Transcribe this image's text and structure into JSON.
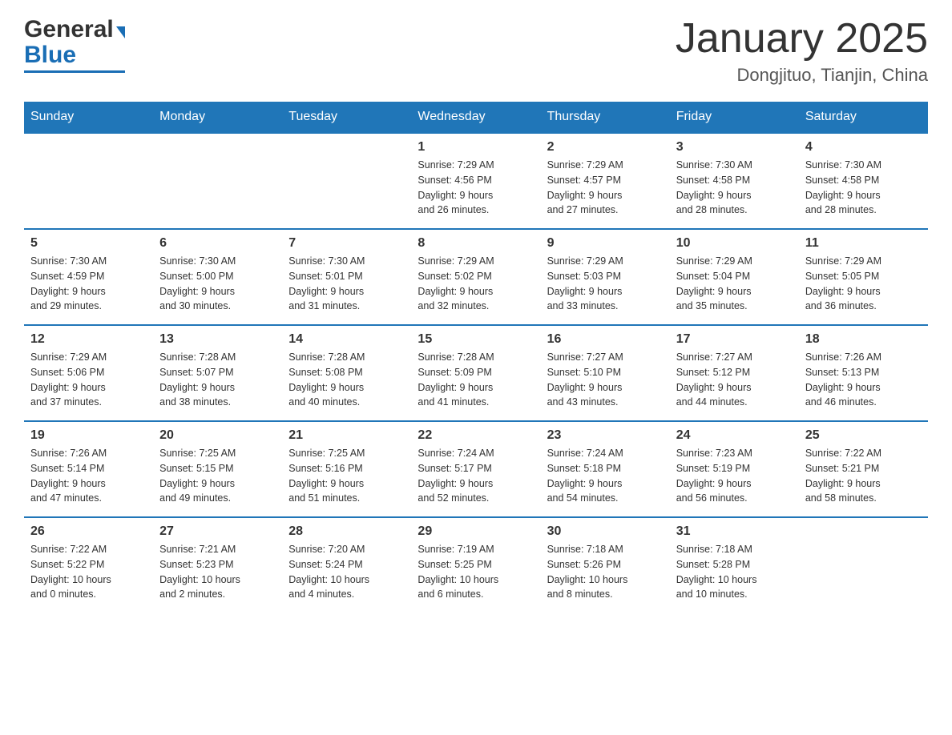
{
  "header": {
    "logo": {
      "general": "General",
      "blue": "Blue",
      "arrow": "▶"
    },
    "title": "January 2025",
    "location": "Dongjituo, Tianjin, China"
  },
  "days_of_week": [
    "Sunday",
    "Monday",
    "Tuesday",
    "Wednesday",
    "Thursday",
    "Friday",
    "Saturday"
  ],
  "weeks": [
    [
      {
        "num": "",
        "info": ""
      },
      {
        "num": "",
        "info": ""
      },
      {
        "num": "",
        "info": ""
      },
      {
        "num": "1",
        "info": "Sunrise: 7:29 AM\nSunset: 4:56 PM\nDaylight: 9 hours\nand 26 minutes."
      },
      {
        "num": "2",
        "info": "Sunrise: 7:29 AM\nSunset: 4:57 PM\nDaylight: 9 hours\nand 27 minutes."
      },
      {
        "num": "3",
        "info": "Sunrise: 7:30 AM\nSunset: 4:58 PM\nDaylight: 9 hours\nand 28 minutes."
      },
      {
        "num": "4",
        "info": "Sunrise: 7:30 AM\nSunset: 4:58 PM\nDaylight: 9 hours\nand 28 minutes."
      }
    ],
    [
      {
        "num": "5",
        "info": "Sunrise: 7:30 AM\nSunset: 4:59 PM\nDaylight: 9 hours\nand 29 minutes."
      },
      {
        "num": "6",
        "info": "Sunrise: 7:30 AM\nSunset: 5:00 PM\nDaylight: 9 hours\nand 30 minutes."
      },
      {
        "num": "7",
        "info": "Sunrise: 7:30 AM\nSunset: 5:01 PM\nDaylight: 9 hours\nand 31 minutes."
      },
      {
        "num": "8",
        "info": "Sunrise: 7:29 AM\nSunset: 5:02 PM\nDaylight: 9 hours\nand 32 minutes."
      },
      {
        "num": "9",
        "info": "Sunrise: 7:29 AM\nSunset: 5:03 PM\nDaylight: 9 hours\nand 33 minutes."
      },
      {
        "num": "10",
        "info": "Sunrise: 7:29 AM\nSunset: 5:04 PM\nDaylight: 9 hours\nand 35 minutes."
      },
      {
        "num": "11",
        "info": "Sunrise: 7:29 AM\nSunset: 5:05 PM\nDaylight: 9 hours\nand 36 minutes."
      }
    ],
    [
      {
        "num": "12",
        "info": "Sunrise: 7:29 AM\nSunset: 5:06 PM\nDaylight: 9 hours\nand 37 minutes."
      },
      {
        "num": "13",
        "info": "Sunrise: 7:28 AM\nSunset: 5:07 PM\nDaylight: 9 hours\nand 38 minutes."
      },
      {
        "num": "14",
        "info": "Sunrise: 7:28 AM\nSunset: 5:08 PM\nDaylight: 9 hours\nand 40 minutes."
      },
      {
        "num": "15",
        "info": "Sunrise: 7:28 AM\nSunset: 5:09 PM\nDaylight: 9 hours\nand 41 minutes."
      },
      {
        "num": "16",
        "info": "Sunrise: 7:27 AM\nSunset: 5:10 PM\nDaylight: 9 hours\nand 43 minutes."
      },
      {
        "num": "17",
        "info": "Sunrise: 7:27 AM\nSunset: 5:12 PM\nDaylight: 9 hours\nand 44 minutes."
      },
      {
        "num": "18",
        "info": "Sunrise: 7:26 AM\nSunset: 5:13 PM\nDaylight: 9 hours\nand 46 minutes."
      }
    ],
    [
      {
        "num": "19",
        "info": "Sunrise: 7:26 AM\nSunset: 5:14 PM\nDaylight: 9 hours\nand 47 minutes."
      },
      {
        "num": "20",
        "info": "Sunrise: 7:25 AM\nSunset: 5:15 PM\nDaylight: 9 hours\nand 49 minutes."
      },
      {
        "num": "21",
        "info": "Sunrise: 7:25 AM\nSunset: 5:16 PM\nDaylight: 9 hours\nand 51 minutes."
      },
      {
        "num": "22",
        "info": "Sunrise: 7:24 AM\nSunset: 5:17 PM\nDaylight: 9 hours\nand 52 minutes."
      },
      {
        "num": "23",
        "info": "Sunrise: 7:24 AM\nSunset: 5:18 PM\nDaylight: 9 hours\nand 54 minutes."
      },
      {
        "num": "24",
        "info": "Sunrise: 7:23 AM\nSunset: 5:19 PM\nDaylight: 9 hours\nand 56 minutes."
      },
      {
        "num": "25",
        "info": "Sunrise: 7:22 AM\nSunset: 5:21 PM\nDaylight: 9 hours\nand 58 minutes."
      }
    ],
    [
      {
        "num": "26",
        "info": "Sunrise: 7:22 AM\nSunset: 5:22 PM\nDaylight: 10 hours\nand 0 minutes."
      },
      {
        "num": "27",
        "info": "Sunrise: 7:21 AM\nSunset: 5:23 PM\nDaylight: 10 hours\nand 2 minutes."
      },
      {
        "num": "28",
        "info": "Sunrise: 7:20 AM\nSunset: 5:24 PM\nDaylight: 10 hours\nand 4 minutes."
      },
      {
        "num": "29",
        "info": "Sunrise: 7:19 AM\nSunset: 5:25 PM\nDaylight: 10 hours\nand 6 minutes."
      },
      {
        "num": "30",
        "info": "Sunrise: 7:18 AM\nSunset: 5:26 PM\nDaylight: 10 hours\nand 8 minutes."
      },
      {
        "num": "31",
        "info": "Sunrise: 7:18 AM\nSunset: 5:28 PM\nDaylight: 10 hours\nand 10 minutes."
      },
      {
        "num": "",
        "info": ""
      }
    ]
  ],
  "colors": {
    "header_bg": "#2076b8",
    "header_text": "#ffffff",
    "border": "#2076b8"
  }
}
